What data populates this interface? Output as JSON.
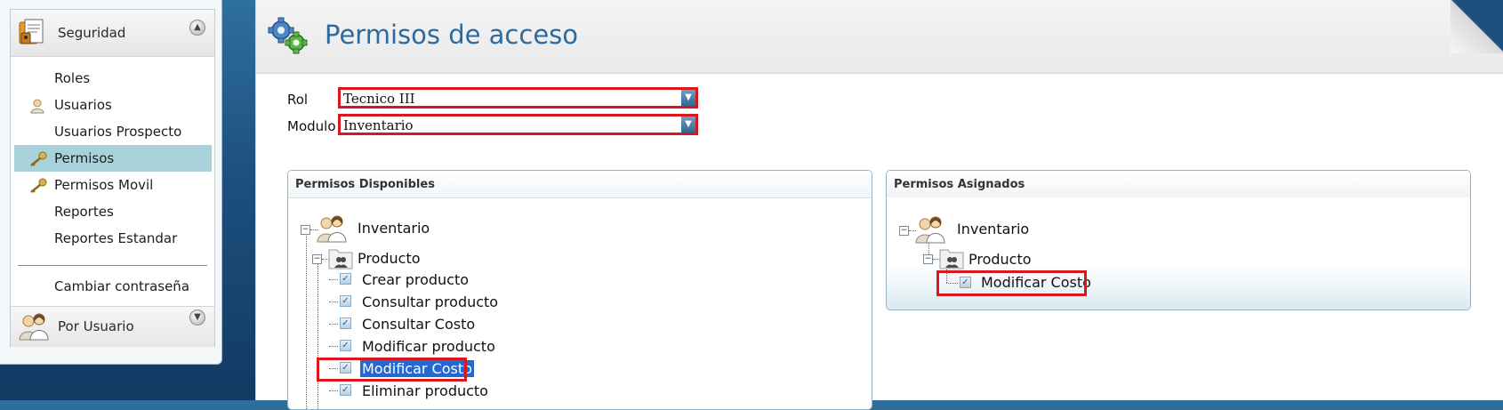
{
  "sidebar": {
    "header_title": "Seguridad",
    "items": [
      {
        "label": "Roles",
        "icon": "none"
      },
      {
        "label": "Usuarios",
        "icon": "user-icon"
      },
      {
        "label": "Usuarios Prospecto",
        "icon": "none"
      },
      {
        "label": "Permisos",
        "icon": "key-icon",
        "active": true
      },
      {
        "label": "Permisos Movil",
        "icon": "key-icon"
      },
      {
        "label": "Reportes",
        "icon": "none"
      },
      {
        "label": "Reportes Estandar",
        "icon": "none"
      },
      {
        "label": "Cambiar contraseña",
        "icon": "none"
      }
    ],
    "footer_title": "Por Usuario"
  },
  "page": {
    "title": "Permisos de acceso"
  },
  "form": {
    "rol_label": "Rol",
    "rol_value": "Tecnico III",
    "modulo_label": "Modulo",
    "modulo_value": "Inventario"
  },
  "available": {
    "title": "Permisos Disponibles",
    "root": "Inventario",
    "folder": "Producto",
    "items": [
      "Crear producto",
      "Consultar producto",
      "Consultar Costo",
      "Modificar producto",
      "Modificar Costo",
      "Eliminar producto"
    ],
    "selected_index": 4
  },
  "assigned": {
    "title": "Permisos Asignados",
    "root": "Inventario",
    "folder": "Producto",
    "items": [
      "Modificar Costo"
    ]
  },
  "colors": {
    "accent_title": "#2c6aa0",
    "highlight_red": "#d9171e",
    "active_item": "#a8d2d9",
    "selection_blue": "#2468d3"
  }
}
